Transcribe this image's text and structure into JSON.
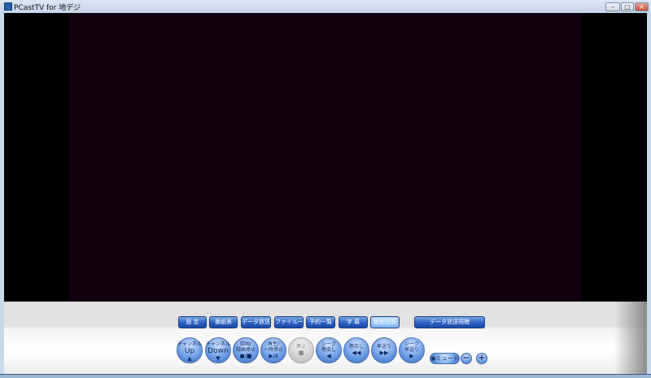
{
  "window": {
    "title": "PCastTV for 地デジ",
    "minimize": "–",
    "maximize": "□",
    "close": "×",
    "close_color": "#d9534f"
  },
  "colors": {
    "video_bg": "#10000f",
    "accent": "#2a5fc2"
  },
  "top_buttons": [
    "設 定",
    "番組表",
    "データ放送",
    "ファイル一覧",
    "予約一覧",
    "字 幕",
    "番組情報"
  ],
  "data_view_button": "データ放送視聴",
  "round_buttons": [
    {
      "line1": "チャンネル",
      "big": "Up",
      "sym": "▲"
    },
    {
      "line1": "チャンネル",
      "big": "Down",
      "sym": "▼"
    },
    {
      "line1": "録画/",
      "line2": "録画停止",
      "sym": "●/■"
    },
    {
      "line1": "再生/",
      "line2": "一時停止",
      "sym": "▶/Ⅱ"
    },
    {
      "line1": "停止",
      "sym": "■"
    },
    {
      "line1": "シーク",
      "line2": "巻戻し",
      "sym": "◀"
    },
    {
      "line1": "巻戻し",
      "sym": "◀◀"
    },
    {
      "line1": "早送り",
      "sym": "▶▶"
    },
    {
      "line1": "シーク",
      "line2": "早送り",
      "sym": "▶"
    }
  ],
  "mute_label": "ミュート",
  "volume_down": "−",
  "volume_up": "+"
}
